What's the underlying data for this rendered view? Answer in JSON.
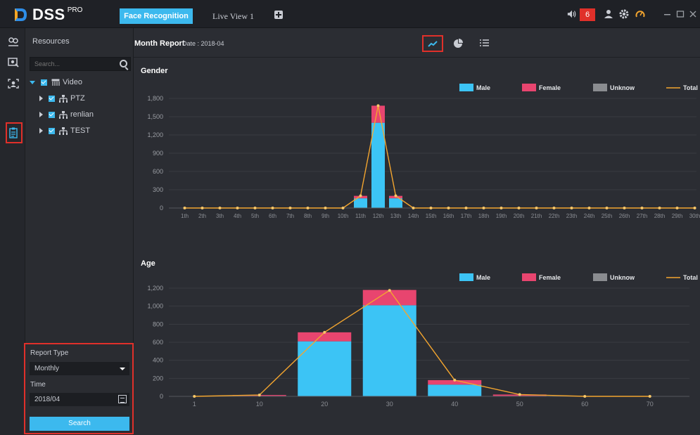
{
  "app": {
    "name": "DSS",
    "edition": "PRO"
  },
  "tabs": [
    {
      "label": "Face Recognition",
      "active": true
    },
    {
      "label": "Live View 1",
      "active": false
    }
  ],
  "topbar": {
    "alarm_count": "6",
    "colors": {
      "accent": "#3cb9ee",
      "alarm": "#e0302a"
    }
  },
  "rail": {
    "items": [
      "face-compare-icon",
      "face-search-icon",
      "face-library-icon",
      "report-icon"
    ]
  },
  "resources": {
    "title": "Resources",
    "search_placeholder": "Search...",
    "tree": [
      {
        "label": "Video",
        "level": 0,
        "expanded": true
      },
      {
        "label": "PTZ",
        "level": 1,
        "expanded": false
      },
      {
        "label": "renlian",
        "level": 1,
        "expanded": false
      },
      {
        "label": "TEST",
        "level": 1,
        "expanded": false
      }
    ]
  },
  "report_form": {
    "type_label": "Report Type",
    "type_value": "Monthly",
    "time_label": "Time",
    "time_value": "2018/04",
    "search_label": "Search"
  },
  "main": {
    "title": "Month Report",
    "date_label": "Date : 2018-04",
    "view_tabs": [
      "line-chart-icon",
      "pie-chart-icon",
      "list-icon"
    ]
  },
  "chart_data": [
    {
      "type": "bar",
      "title": "Gender",
      "stacked": true,
      "categories": [
        "1th",
        "2th",
        "3th",
        "4th",
        "5th",
        "6th",
        "7th",
        "8th",
        "9th",
        "10th",
        "11th",
        "12th",
        "13th",
        "14th",
        "15th",
        "16th",
        "17th",
        "18th",
        "19th",
        "20th",
        "21th",
        "22th",
        "23th",
        "24th",
        "25th",
        "26th",
        "27th",
        "28th",
        "29th",
        "30th"
      ],
      "series": [
        {
          "name": "Male",
          "color": "#3cc4f5",
          "values": [
            0,
            0,
            0,
            0,
            0,
            0,
            0,
            0,
            0,
            0,
            160,
            1400,
            160,
            0,
            0,
            0,
            0,
            0,
            0,
            0,
            0,
            0,
            0,
            0,
            0,
            0,
            0,
            0,
            0,
            0
          ]
        },
        {
          "name": "Female",
          "color": "#e8456f",
          "values": [
            0,
            0,
            0,
            0,
            0,
            0,
            0,
            0,
            0,
            0,
            40,
            280,
            40,
            0,
            0,
            0,
            0,
            0,
            0,
            0,
            0,
            0,
            0,
            0,
            0,
            0,
            0,
            0,
            0,
            0
          ]
        },
        {
          "name": "Unknow",
          "color": "#8a8c90",
          "values": [
            0,
            0,
            0,
            0,
            0,
            0,
            0,
            0,
            0,
            0,
            0,
            0,
            0,
            0,
            0,
            0,
            0,
            0,
            0,
            0,
            0,
            0,
            0,
            0,
            0,
            0,
            0,
            0,
            0,
            0
          ]
        }
      ],
      "line": {
        "name": "Total",
        "color": "#f3a52f",
        "values": [
          0,
          0,
          0,
          0,
          0,
          0,
          0,
          0,
          0,
          0,
          200,
          1680,
          200,
          0,
          0,
          0,
          0,
          0,
          0,
          0,
          0,
          0,
          0,
          0,
          0,
          0,
          0,
          0,
          0,
          0
        ]
      },
      "yticks": [
        "0",
        "300",
        "600",
        "900",
        "1,200",
        "1,500",
        "1,800"
      ],
      "ylim": [
        0,
        1800
      ],
      "legend": "top-right"
    },
    {
      "type": "bar",
      "title": "Age",
      "stacked": true,
      "categories": [
        "1",
        "10",
        "20",
        "30",
        "40",
        "50",
        "60",
        "70"
      ],
      "series": [
        {
          "name": "Male",
          "color": "#3cc4f5",
          "values": [
            0,
            5,
            610,
            1010,
            130,
            5,
            0,
            0
          ]
        },
        {
          "name": "Female",
          "color": "#e8456f",
          "values": [
            0,
            10,
            100,
            170,
            50,
            15,
            0,
            0
          ]
        },
        {
          "name": "Unknow",
          "color": "#8a8c90",
          "values": [
            0,
            0,
            0,
            0,
            0,
            0,
            0,
            0
          ]
        }
      ],
      "line": {
        "name": "Total",
        "color": "#f3a52f",
        "values": [
          0,
          15,
          710,
          1175,
          180,
          20,
          0,
          0
        ]
      },
      "yticks": [
        "0",
        "200",
        "400",
        "600",
        "800",
        "1,000",
        "1,200"
      ],
      "ylim": [
        0,
        1200
      ],
      "legend": "top-right"
    }
  ]
}
